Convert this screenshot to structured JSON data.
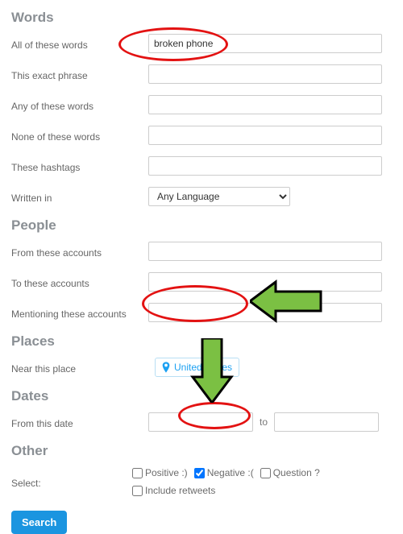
{
  "sections": {
    "words": "Words",
    "people": "People",
    "places": "Places",
    "dates": "Dates",
    "other": "Other"
  },
  "words": {
    "all_label": "All of these words",
    "all_value": "broken phone",
    "exact_label": "This exact phrase",
    "exact_value": "",
    "any_label": "Any of these words",
    "any_value": "",
    "none_label": "None of these words",
    "none_value": "",
    "tags_label": "These hashtags",
    "tags_value": "",
    "lang_label": "Written in",
    "lang_value": "Any Language"
  },
  "people": {
    "from_label": "From these accounts",
    "from_value": "",
    "to_label": "To these accounts",
    "to_value": "",
    "ment_label": "Mentioning these accounts",
    "ment_value": ""
  },
  "places": {
    "near_label": "Near this place",
    "tag": "United States"
  },
  "dates": {
    "from_label": "From this date",
    "from_value": "",
    "sep": "to",
    "to_value": ""
  },
  "other": {
    "select_label": "Select:",
    "pos": "Positive :)",
    "neg": "Negative :(",
    "q": "Question ?",
    "rt": "Include retweets",
    "pos_checked": false,
    "neg_checked": true,
    "q_checked": false,
    "rt_checked": false
  },
  "action": {
    "search": "Search"
  }
}
